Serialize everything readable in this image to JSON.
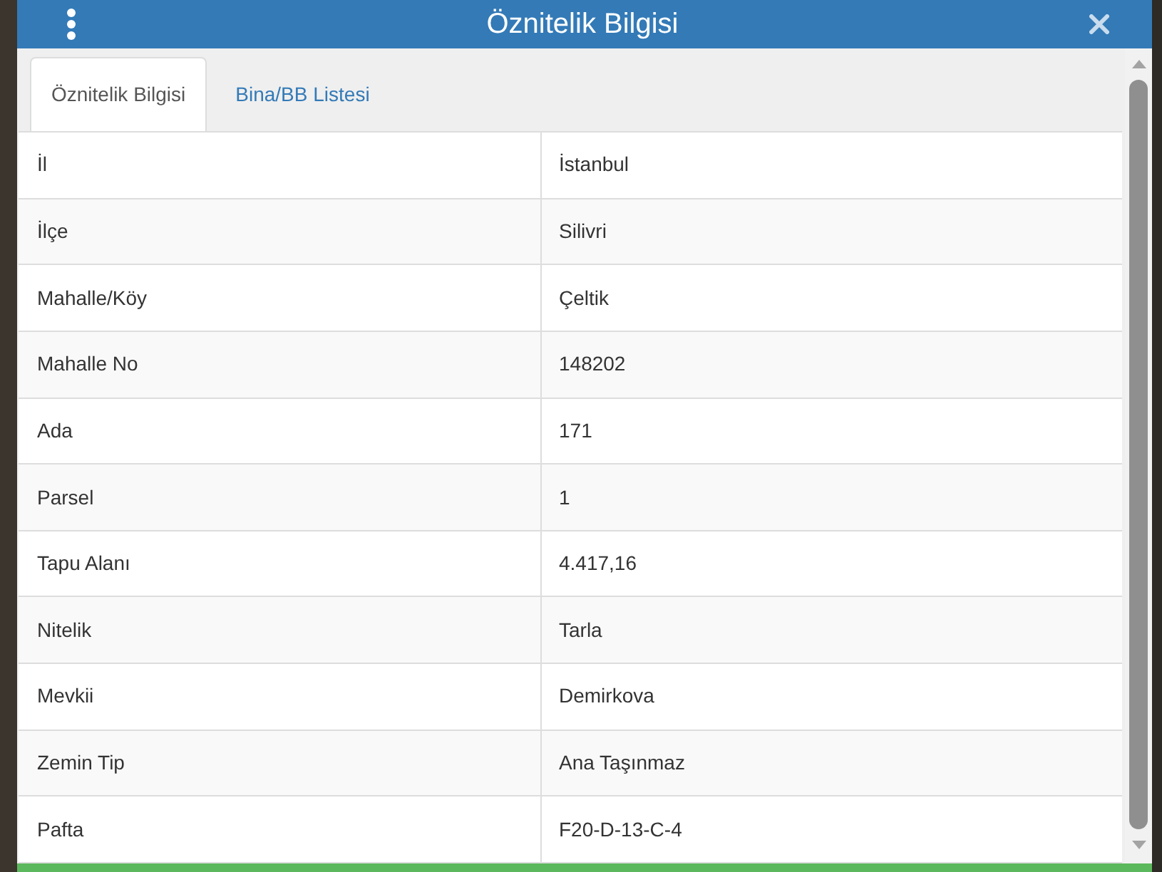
{
  "dialog": {
    "title": "Öznitelik Bilgisi"
  },
  "tabs": [
    {
      "label": "Öznitelik Bilgisi",
      "selected": true
    },
    {
      "label": "Bina/BB Listesi",
      "selected": false
    }
  ],
  "attributes": [
    {
      "name": "İl",
      "value": "İstanbul"
    },
    {
      "name": "İlçe",
      "value": "Silivri"
    },
    {
      "name": "Mahalle/Köy",
      "value": "Çeltik"
    },
    {
      "name": "Mahalle No",
      "value": "148202"
    },
    {
      "name": "Ada",
      "value": "171"
    },
    {
      "name": "Parsel",
      "value": "1"
    },
    {
      "name": "Tapu Alanı",
      "value": "4.417,16"
    },
    {
      "name": "Nitelik",
      "value": "Tarla"
    },
    {
      "name": "Mevkii",
      "value": "Demirkova"
    },
    {
      "name": "Zemin Tip",
      "value": "Ana Taşınmaz"
    },
    {
      "name": "Pafta",
      "value": "F20-D-13-C-4"
    }
  ]
}
